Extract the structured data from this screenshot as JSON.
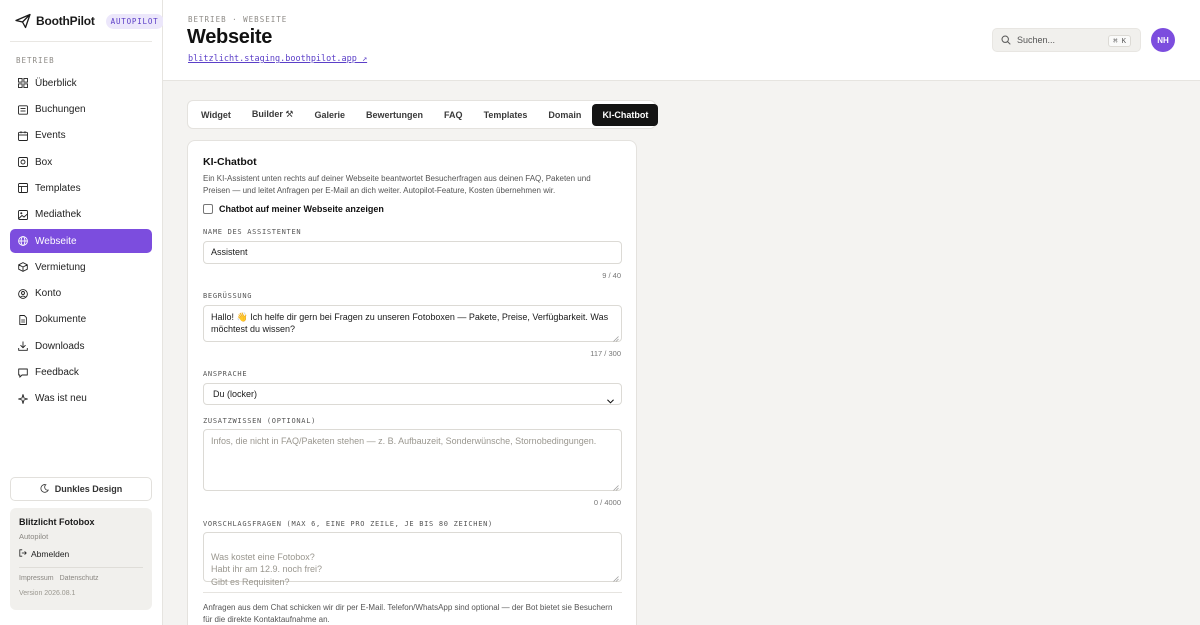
{
  "brand": {
    "name": "BoothPilot",
    "badge": "AUTOPILOT"
  },
  "sidebar": {
    "section": "BETRIEB",
    "items": [
      {
        "label": "Überblick",
        "icon": "grid-icon",
        "active": false
      },
      {
        "label": "Buchungen",
        "icon": "list-icon",
        "active": false
      },
      {
        "label": "Events",
        "icon": "calendar-icon",
        "active": false
      },
      {
        "label": "Box",
        "icon": "box-icon",
        "active": false
      },
      {
        "label": "Templates",
        "icon": "template-icon",
        "active": false
      },
      {
        "label": "Mediathek",
        "icon": "image-icon",
        "active": false
      },
      {
        "label": "Webseite",
        "icon": "globe-icon",
        "active": true
      },
      {
        "label": "Vermietung",
        "icon": "package-icon",
        "active": false
      },
      {
        "label": "Konto",
        "icon": "user-icon",
        "active": false
      },
      {
        "label": "Dokumente",
        "icon": "document-icon",
        "active": false
      },
      {
        "label": "Downloads",
        "icon": "download-icon",
        "active": false
      },
      {
        "label": "Feedback",
        "icon": "message-icon",
        "active": false
      },
      {
        "label": "Was ist neu",
        "icon": "sparkle-icon",
        "active": false
      }
    ],
    "theme_button": "Dunkles Design",
    "account": {
      "name": "Blitzlicht Fotobox",
      "plan": "Autopilot",
      "logout": "Abmelden",
      "links": [
        "Impressum",
        "Datenschutz"
      ],
      "version": "Version 2026.08.1"
    }
  },
  "header": {
    "breadcrumb": "BETRIEB · WEBSEITE",
    "title": "Webseite",
    "site_link": "blitzlicht.staging.boothpilot.app ↗",
    "search_placeholder": "Suchen...",
    "search_shortcut": "⌘ K",
    "avatar_initials": "NH"
  },
  "tabs": [
    {
      "label": "Widget",
      "active": false
    },
    {
      "label": "Builder ⚒",
      "active": false
    },
    {
      "label": "Galerie",
      "active": false
    },
    {
      "label": "Bewertungen",
      "active": false
    },
    {
      "label": "FAQ",
      "active": false
    },
    {
      "label": "Templates",
      "active": false
    },
    {
      "label": "Domain",
      "active": false
    },
    {
      "label": "KI-Chatbot",
      "active": true
    }
  ],
  "chatbot": {
    "title": "KI-Chatbot",
    "description": "Ein KI-Assistent unten rechts auf deiner Webseite beantwortet Besucherfragen aus deinen FAQ, Paketen und Preisen — und leitet Anfragen per E-Mail an dich weiter. Autopilot-Feature, Kosten übernehmen wir.",
    "show_checkbox_label": "Chatbot auf meiner Webseite anzeigen",
    "show_checked": false,
    "name_label": "NAME DES ASSISTENTEN",
    "name_value": "Assistent",
    "name_counter": "9 / 40",
    "greeting_label": "BEGRÜSSUNG",
    "greeting_value": "Hallo! 👋 Ich helfe dir gern bei Fragen zu unseren Fotoboxen — Pakete, Preise, Verfügbarkeit. Was möchtest du wissen?",
    "greeting_counter": "117 / 300",
    "tone_label": "ANSPRACHE",
    "tone_value": "Du (locker)",
    "knowledge_label": "ZUSATZWISSEN (OPTIONAL)",
    "knowledge_placeholder": "Infos, die nicht in FAQ/Paketen stehen — z. B. Aufbauzeit, Sonderwünsche, Stornobedingungen.",
    "knowledge_counter": "0 / 4000",
    "suggestions_label": "VORSCHLAGSFRAGEN (MAX 6, EINE PRO ZEILE, JE BIS 80 ZEICHEN)",
    "suggestions_placeholder": "Was kostet eine Fotobox?\nHabt ihr am 12.9. noch frei?\nGibt es Requisiten?",
    "footnote": "Anfragen aus dem Chat schicken wir dir per E-Mail. Telefon/WhatsApp sind optional — der Bot bietet sie Besuchern für die direkte Kontaktaufnahme an."
  },
  "colors": {
    "accent": "#7c4dde",
    "active_tab": "#141414",
    "link": "#5b3fc8"
  }
}
